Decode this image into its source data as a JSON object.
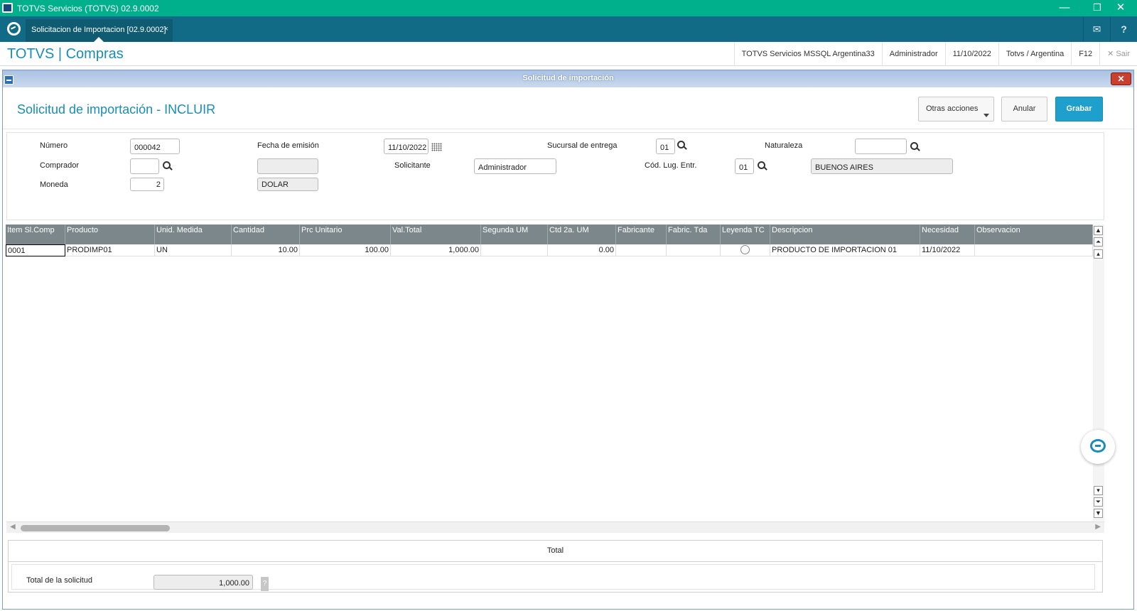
{
  "os": {
    "title": "TOTVS Servicios (TOTVS) 02.9.0002",
    "minimize": "—",
    "restore": "❐",
    "close": "✕"
  },
  "app": {
    "tab_label": "Solicitacion de Importacion [02.9.0002]",
    "tab_close": "×",
    "mail_icon": "✉",
    "help_icon": "?"
  },
  "header": {
    "brand": "TOTVS | Compras",
    "items": [
      "TOTVS Servicios MSSQL Argentina33",
      "Administrador",
      "11/10/2022",
      "Totvs / Argentina",
      "F12"
    ],
    "exit_label": "✕  Sair"
  },
  "window": {
    "title": "Solicitud de importación",
    "close": "✕"
  },
  "page": {
    "title": "Solicitud de importación - INCLUIR",
    "actions": {
      "more": "Otras acciones",
      "cancel": "Anular",
      "save": "Grabar"
    }
  },
  "form": {
    "numero_label": "Número",
    "numero_value": "000042",
    "fecha_label": "Fecha de emisión",
    "fecha_value": "11/10/2022",
    "sucursal_label": "Sucursal de entrega",
    "sucursal_value": "01",
    "naturaleza_label": "Naturaleza",
    "naturaleza_value": "",
    "comprador_label": "Comprador",
    "comprador_value": "",
    "comprador_desc": "",
    "solicitante_label": "Solicitante",
    "solicitante_value": "Administrador",
    "lug_entr_label": "Cód. Lug. Entr.",
    "lug_entr_value": "01",
    "lug_entr_desc": "BUENOS AIRES",
    "moneda_label": "Moneda",
    "moneda_value": "2",
    "moneda_desc": "DOLAR"
  },
  "grid": {
    "columns": [
      "Item Sl.Comp",
      "Producto",
      "Unid. Medida",
      "Cantidad",
      "Prc Unitario",
      "Val.Total",
      "Segunda UM",
      "Ctd 2a. UM",
      "Fabricante",
      "Fabric. Tda",
      "Leyenda TC",
      "Descripcion",
      "Necesidad",
      "Observacion"
    ],
    "rows": [
      [
        "0001",
        "PRODIMP01",
        "UN",
        "10.00",
        "100.00",
        "1,000.00",
        "",
        "0.00",
        "",
        "",
        "",
        "PRODUCTO DE IMPORTACION 01",
        "11/10/2022",
        ""
      ]
    ]
  },
  "totals": {
    "header": "Total",
    "label": "Total de la solicitud",
    "value": "1,000.00",
    "help": "?"
  }
}
